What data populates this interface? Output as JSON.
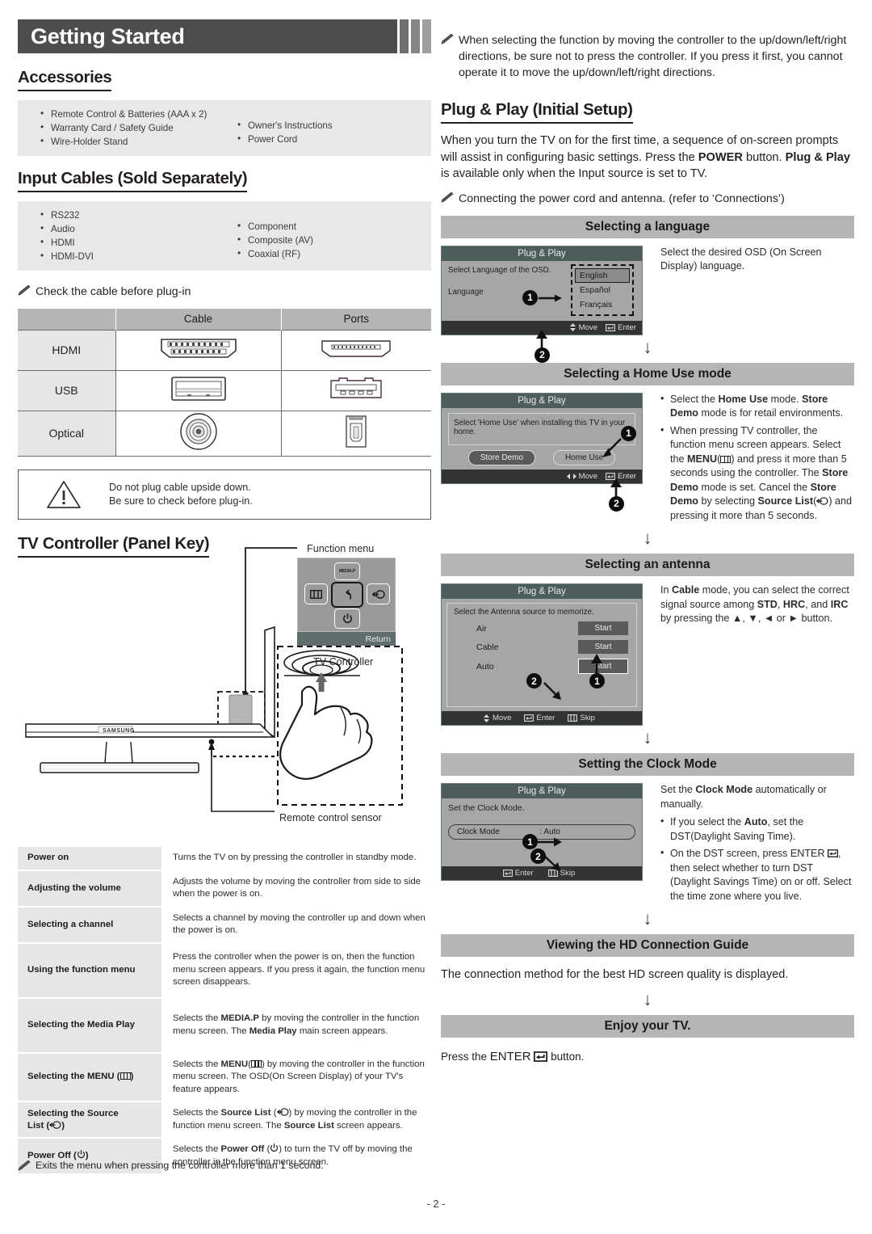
{
  "header": {
    "title": "Getting Started"
  },
  "accessories": {
    "heading": "Accessories",
    "col1": [
      "Remote Control & Batteries (AAA x 2)",
      "Warranty Card / Safety Guide",
      "Wire-Holder Stand"
    ],
    "col2": [
      "Owner's Instructions",
      "Power Cord"
    ]
  },
  "input_cables": {
    "heading": "Input Cables (Sold Separately)",
    "col1": [
      "RS232",
      "Audio",
      "HDMI",
      "HDMI-DVI"
    ],
    "col2": [
      "Component",
      "Composite (AV)",
      "Coaxial (RF)"
    ],
    "note": "Check the cable before plug-in",
    "table": {
      "headers": [
        "",
        "Cable",
        "Ports"
      ],
      "rows": [
        {
          "label": "HDMI",
          "cable_icon": "hdmi-cable-icon",
          "port_icon": "hdmi-port-icon"
        },
        {
          "label": "USB",
          "cable_icon": "usb-cable-icon",
          "port_icon": "usb-port-icon"
        },
        {
          "label": "Optical",
          "cable_icon": "optical-cable-icon",
          "port_icon": "optical-port-icon"
        }
      ]
    },
    "warning": [
      "Do not plug cable upside down.",
      "Be sure to check before plug-in."
    ]
  },
  "tv_controller": {
    "heading": "TV Controller (Panel Key)",
    "labels": {
      "function_menu": "Function menu",
      "tv_controller": "TV Controller",
      "remote_sensor": "Remote control sensor",
      "brand": "SAMSUNG"
    },
    "function_menu_keys": {
      "up": "MEDIA.P",
      "left": "menu-icon",
      "center": "return-icon",
      "right": "source-icon",
      "down": "power-icon",
      "bar": "Return"
    },
    "functions": [
      {
        "key": "Power on",
        "value": "Turns the TV on by pressing the controller in standby mode."
      },
      {
        "key": "Adjusting the volume",
        "value": "Adjusts the volume by moving the controller from side to side when the power is on."
      },
      {
        "key": "Selecting a channel",
        "value": "Selects a channel by moving the controller up and down when the power is on."
      },
      {
        "key": "Using the function menu",
        "value": "Press the controller when the power is on, then the function menu screen appears. If you press it again, the function menu screen disappears."
      },
      {
        "key": "Selecting the Media Play",
        "value": "Selects the MEDIA.P by moving the controller in the function menu screen. The Media Play main screen appears."
      },
      {
        "key": "Selecting the MENU (‖)",
        "value": "Selects the MENU(‖) by moving the controller in the function menu screen. The OSD(On Screen Display) of your TV's feature appears."
      },
      {
        "key": "Selecting the Source List (←)",
        "value": "Selects the Source List (←) by moving the controller in the function menu screen. The Source List screen appears."
      },
      {
        "key": "Power Off (⏻)",
        "value": "Selects the Power Off (⏻) to turn the TV off by moving the controller in the function menu screen."
      }
    ],
    "exit_note": "Exits the menu when pressing the controller more than 1 second."
  },
  "right_column": {
    "top_note": "When selecting the function by moving the controller to the up/down/left/right directions, be sure not to press the controller. If you press it first, you cannot operate it to move the up/down/left/right directions.",
    "plug_play_heading": "Plug & Play (Initial Setup)",
    "plug_play_body": "When you turn the TV on for the first time, a sequence of on-screen prompts will assist in configuring basic settings. Press the POWER button. Plug & Play is available only when the Input source is set to TV.",
    "connect_note": "Connecting the power cord and antenna. (refer to ‘Connections’)",
    "steps": [
      {
        "title": "Selecting a language",
        "osd": {
          "header": "Plug & Play",
          "line1": "Select Language of the OSD.",
          "line2": "Language",
          "options": [
            "English",
            "Español",
            "Français"
          ],
          "selected": "English",
          "footer": [
            "Move",
            "Enter"
          ]
        },
        "desc": "Select the desired OSD (On Screen Display) language.",
        "badges": [
          "1",
          "2"
        ]
      },
      {
        "title": "Selecting a Home Use mode",
        "osd": {
          "header": "Plug & Play",
          "line1": "Select 'Home Use' when installing this TV in your home.",
          "buttons": [
            "Store Demo",
            "Home Use"
          ],
          "footer": [
            "Move",
            "Enter"
          ]
        },
        "desc_bullets": [
          "Select the Home Use mode. Store Demo mode is for retail environments.",
          "When pressing TV controller, the function menu screen appears. Select the MENU(‖) and press it more than 5 seconds using the controller. The Store Demo mode is set. Cancel the Store Demo by selecting Source List(←) and pressing it more than 5 seconds."
        ],
        "badges": [
          "1",
          "2"
        ]
      },
      {
        "title": "Selecting an antenna",
        "osd": {
          "header": "Plug & Play",
          "line1": "Select the Antenna source to memorize.",
          "rows": [
            {
              "label": "Air",
              "button": "Start"
            },
            {
              "label": "Cable",
              "button": "Start"
            },
            {
              "label": "Auto",
              "button": "Start"
            }
          ],
          "footer": [
            "Move",
            "Enter",
            "Skip"
          ]
        },
        "desc": "In Cable mode, you can select the correct signal source among STD, HRC, and IRC by pressing the ▲, ▼, ◀ or ▶ button.",
        "badges": [
          "1",
          "2"
        ]
      },
      {
        "title": "Setting the Clock Mode",
        "osd": {
          "header": "Plug & Play",
          "line1": "Set the Clock Mode.",
          "field_label": "Clock Mode",
          "field_value": ": Auto",
          "footer": [
            "Enter",
            "Skip"
          ]
        },
        "desc_intro": "Set the Clock Mode automatically or manually.",
        "desc_bullets": [
          "If you select the Auto, set the DST(Daylight Saving Time).",
          "On the DST screen, press ENTER ↵, then select whether to turn DST (Daylight Savings Time) on or off. Select the time zone where you live."
        ],
        "badges": [
          "1",
          "2"
        ]
      },
      {
        "title": "Viewing the HD Connection Guide",
        "desc": "The connection method for the best HD screen quality is displayed."
      },
      {
        "title": "Enjoy your TV.",
        "desc": "Press the ENTER ↵ button."
      }
    ]
  },
  "footer": {
    "page": "- 2 -"
  }
}
